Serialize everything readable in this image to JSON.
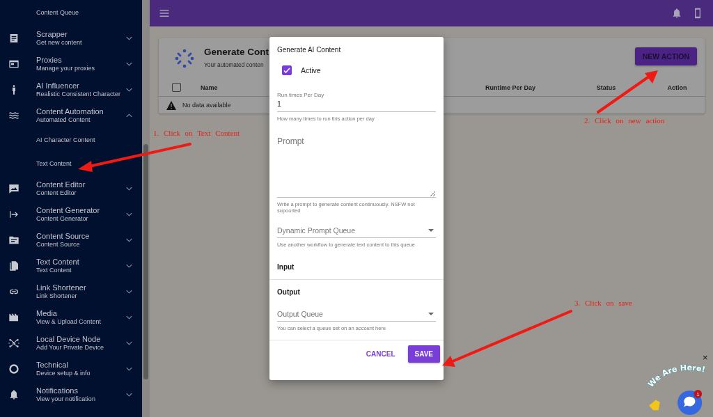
{
  "sidebar": {
    "items": [
      {
        "kind": "sub",
        "title": "Content Queue"
      },
      {
        "kind": "group",
        "title": "Scrapper",
        "subtitle": "Get new content",
        "expanded": false
      },
      {
        "kind": "group",
        "title": "Proxies",
        "subtitle": "Manage your proxies",
        "expanded": false
      },
      {
        "kind": "group",
        "title": "AI Influencer",
        "subtitle": "Realistic Consistent Character",
        "expanded": false
      },
      {
        "kind": "group",
        "title": "Content Automation",
        "subtitle": "Automated Content",
        "expanded": true,
        "children": [
          {
            "title": "AI Character Content"
          },
          {
            "title": "Text Content"
          }
        ]
      },
      {
        "kind": "group",
        "title": "Content Editor",
        "subtitle": "Content Editor",
        "expanded": false
      },
      {
        "kind": "group",
        "title": "Content Generator",
        "subtitle": "Content Generator",
        "expanded": false
      },
      {
        "kind": "group",
        "title": "Content Source",
        "subtitle": "Content Source",
        "expanded": false
      },
      {
        "kind": "group",
        "title": "Text Content",
        "subtitle": "Text Content",
        "expanded": false
      },
      {
        "kind": "group",
        "title": "Link Shortener",
        "subtitle": "Link Shortener",
        "expanded": false
      },
      {
        "kind": "group",
        "title": "Media",
        "subtitle": "View & Upload Content",
        "expanded": false
      },
      {
        "kind": "group",
        "title": "Local Device Node",
        "subtitle": "Add Your Private Device",
        "expanded": false
      },
      {
        "kind": "group",
        "title": "Technical",
        "subtitle": "Device setup & info",
        "expanded": false
      },
      {
        "kind": "group",
        "title": "Notifications",
        "subtitle": "View your notification",
        "expanded": false
      }
    ]
  },
  "page": {
    "title": "Generate Cont",
    "subtitle": "Your automated conten",
    "new_action": "NEW ACTION",
    "table": {
      "select_all_checked": false,
      "columns": [
        "Name",
        "Runtime Per Day",
        "Status",
        "Action"
      ],
      "empty_text": "No data available"
    }
  },
  "dialog": {
    "title": "Generate AI Content",
    "active": {
      "label": "Active",
      "checked": true
    },
    "run_times": {
      "label": "Run times Per Day",
      "value": "1",
      "hint": "How many times to run this action per day"
    },
    "prompt": {
      "placeholder": "Prompt",
      "hint": "Write a prompt to generate content continuously. NSFW not supoorted"
    },
    "dynamic_queue": {
      "placeholder": "Dynamic Prompt Queue",
      "hint": "Use another workflow to generate text content to this queue"
    },
    "input_heading": "Input",
    "output_heading": "Output",
    "output_queue": {
      "placeholder": "Output Queue",
      "hint": "You can select a queue set on an account here"
    },
    "buttons": [
      {
        "label": "CANCEL",
        "kind": "text"
      },
      {
        "label": "SAVE",
        "kind": "primary"
      }
    ]
  },
  "annotations": [
    {
      "text": "1. Click on Text Content"
    },
    {
      "text": "2. Click on new action"
    },
    {
      "text": "3. Click on save"
    }
  ],
  "chat_widget": {
    "banner": "We Are Here!",
    "badge": "1",
    "close": "×"
  }
}
